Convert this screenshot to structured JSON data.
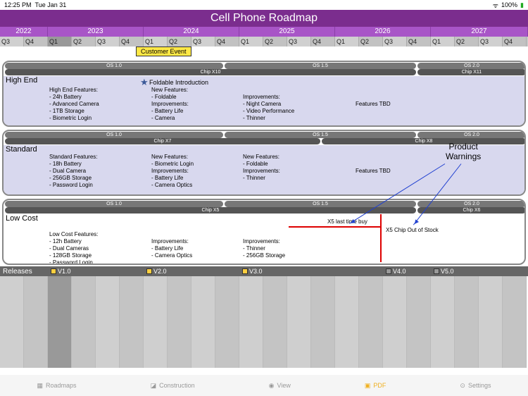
{
  "statusbar": {
    "time": "12:25 PM",
    "date": "Tue Jan 31",
    "battery": "100%"
  },
  "title": "Cell Phone Roadmap",
  "years": [
    "2022",
    "2023",
    "2024",
    "2025",
    "2026",
    "2027"
  ],
  "quarters": [
    "Q3",
    "Q4",
    "Q1",
    "Q2",
    "Q3",
    "Q4",
    "Q1",
    "Q2",
    "Q3",
    "Q4",
    "Q1",
    "Q2",
    "Q3",
    "Q4",
    "Q1",
    "Q2",
    "Q3",
    "Q4",
    "Q1",
    "Q2",
    "Q3",
    "Q4"
  ],
  "event": {
    "label": "Customer Event"
  },
  "os": {
    "v1": "OS 1.0",
    "v15": "OS 1.5",
    "v2": "OS 2.0"
  },
  "highend": {
    "label": "High End",
    "chip1": "Chip X10",
    "chip2": "Chip X11",
    "star": "Foldable Introduction",
    "n1t": "High End Features:",
    "n1a": "- 24h Battery",
    "n1b": "- Advanced Camera",
    "n1c": "- 1TB Storage",
    "n1d": "- Biometric Login",
    "n2t": "New Features:",
    "n2a": "- Foldable",
    "n2i": "Improvements:",
    "n2b": "- Battery Life",
    "n2c": "- Camera",
    "n3t": "Improvements:",
    "n3a": "- Night Camera",
    "n3b": "- Video Performance",
    "n3c": "- Thinner",
    "n4": "Features TBD"
  },
  "standard": {
    "label": "Standard",
    "chip1": "Chip X7",
    "chip2": "Chip X8",
    "n1t": "Standard Features:",
    "n1a": "- 18h Battery",
    "n1b": "- Dual Camera",
    "n1c": "- 256GB Storage",
    "n1d": "- Password Login",
    "n2t": "New Features:",
    "n2a": "- Biometric Login",
    "n2i": "Improvements:",
    "n2b": "- Battery Life",
    "n2c": "- Camera Optics",
    "n3t": "New Features:",
    "n3a": "- Foldable",
    "n3i": "Improvements:",
    "n3b": "- Thinner",
    "n4": "Features TBD"
  },
  "lowcost": {
    "label": "Low Cost",
    "chip1": "Chip X5",
    "chip2": "Chip X6",
    "warn1": "X5 last time buy",
    "warn2": "X5 Chip Out of Stock",
    "n1t": "Low Cost Features:",
    "n1a": "- 12h Battery",
    "n1b": "- Dual Cameras",
    "n1c": "- 128GB Storage",
    "n1d": "- Password Login",
    "n2t": "Improvements:",
    "n2a": "- Battery Life",
    "n2b": "- Camera Optics",
    "n3t": "Improvements:",
    "n3a": "- Thinner",
    "n3b": "- 256GB Storage"
  },
  "warnlabel": {
    "l1": "Product",
    "l2": "Warnings"
  },
  "releases": {
    "label": "Releases",
    "v1": "V1.0",
    "v2": "V2.0",
    "v3": "V3.0",
    "v4": "V4.0",
    "v5": "V5.0"
  },
  "tabs": {
    "roadmaps": "Roadmaps",
    "construction": "Construction",
    "view": "View",
    "pdf": "PDF",
    "settings": "Settings"
  }
}
